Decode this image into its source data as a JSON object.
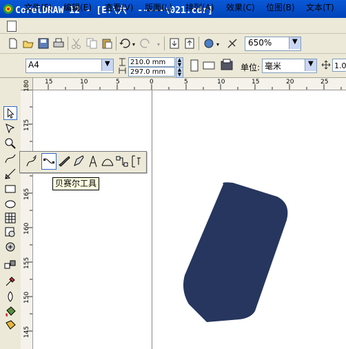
{
  "window": {
    "title": "CorelDRAW 12 - [E:\\六  -----\\021.cdr]"
  },
  "menu": {
    "items": [
      {
        "label": "文件(F)"
      },
      {
        "label": "编辑(E)"
      },
      {
        "label": "查看(V)"
      },
      {
        "label": "版面(L)"
      },
      {
        "label": "排列(A)"
      },
      {
        "label": "效果(C)"
      },
      {
        "label": "位图(B)"
      },
      {
        "label": "文本(T)"
      }
    ]
  },
  "toolbar": {
    "icons": [
      "new-icon",
      "open-icon",
      "save-icon",
      "print-icon",
      "cut-icon",
      "copy-icon",
      "paste-icon",
      "undo-icon",
      "redo-icon",
      "import-icon",
      "export-icon",
      "app-launcher-icon",
      "corel-online-icon"
    ],
    "zoom": "650%"
  },
  "propertybar": {
    "page_size": "A4",
    "width": "210.0 mm",
    "height": "297.0 mm",
    "unit_label": "单位:",
    "unit": "毫米",
    "nudge": "1.0"
  },
  "rulers": {
    "horizontal_ticks": [
      "15",
      "10",
      "5",
      "0",
      "5",
      "10",
      "15",
      "20",
      "25"
    ],
    "vertical_ticks": [
      "180",
      "175",
      "170",
      "165",
      "160",
      "155",
      "150",
      "145"
    ]
  },
  "flyout": {
    "tools": [
      "freehand-icon",
      "bezier-icon",
      "artistic-media-icon",
      "pen-icon",
      "polyline-icon",
      "3point-curve-icon",
      "interactive-connector-icon",
      "dimension-icon"
    ]
  },
  "tooltip": {
    "text": "贝赛尔工具"
  },
  "colors": {
    "titlebar": "#0a58d8",
    "shape_fill": "#26365e",
    "chrome": "#ece9d8"
  }
}
